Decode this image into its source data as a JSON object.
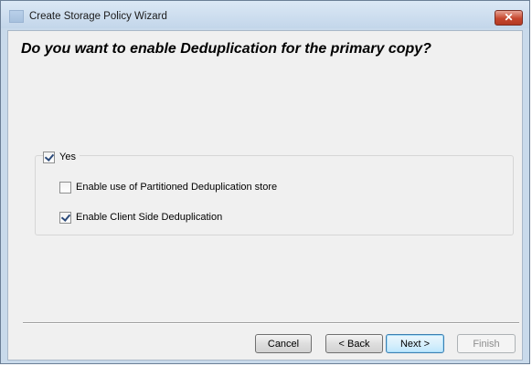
{
  "window": {
    "title": "Create Storage Policy Wizard",
    "close_glyph": "✕",
    "app_icon": "app-icon"
  },
  "content": {
    "question": "Do you want to enable Deduplication for the primary copy?"
  },
  "dedup": {
    "yes_label": "Yes",
    "yes_checked": true,
    "options": [
      {
        "label": "Enable use of Partitioned Deduplication store",
        "checked": false
      },
      {
        "label": "Enable Client Side Deduplication",
        "checked": true
      }
    ]
  },
  "buttons": {
    "cancel": "Cancel",
    "back": "< Back",
    "next": "Next >",
    "finish": "Finish",
    "finish_enabled": false
  },
  "colors": {
    "title_bar": "#c9daeb",
    "close_button": "#c6472f",
    "client_bg": "#f0f0f0",
    "default_button_border": "#3c7fb1"
  }
}
